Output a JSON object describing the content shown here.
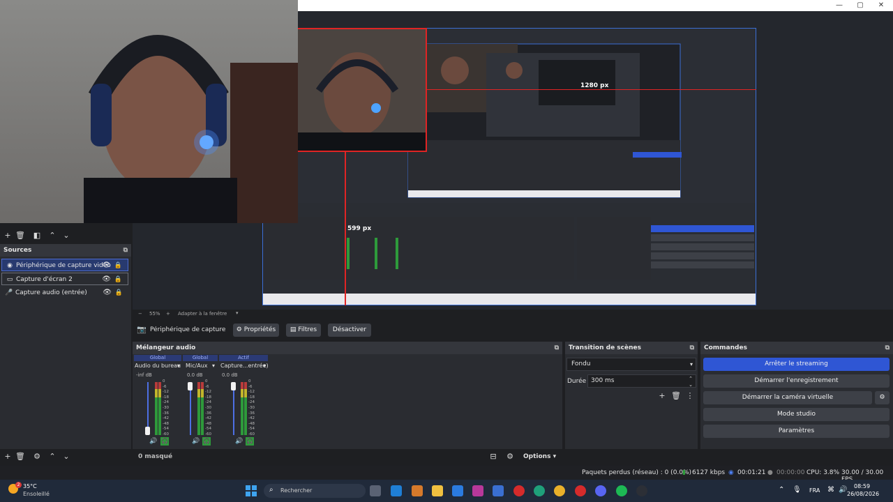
{
  "window": {
    "controls": {
      "minimize": "—",
      "maximize": "▢",
      "close": "✕"
    }
  },
  "preview": {
    "size_label_top": "1280 px",
    "size_label_left": "599 px",
    "zoom_minus": "−",
    "zoom": "55%",
    "zoom_plus": "+",
    "fit": "Adapter à la fenêtre"
  },
  "source_toolbar": {
    "source_name": "Périphérique de capture vidéo",
    "properties": "Propriétés",
    "filters": "Filtres",
    "deactivate": "Désactiver"
  },
  "sources": {
    "title": "Sources",
    "items": [
      {
        "label": "Périphérique de capture vidéo",
        "icon": "camera-icon"
      },
      {
        "label": "Capture d'écran 2",
        "icon": "monitor-icon"
      },
      {
        "label": "Capture audio (entrée)",
        "icon": "microphone-icon"
      }
    ]
  },
  "mixer": {
    "title": "Mélangeur audio",
    "channels": [
      {
        "badge": "Global",
        "name": "Audio du bureau",
        "db": "-inf dB",
        "fader_level": 0.1
      },
      {
        "badge": "Global",
        "name": "Mic/Aux",
        "db": "0.0 dB",
        "fader_level": 1.0
      },
      {
        "badge": "Actif",
        "name": "Capture...entrée)",
        "db": "0.0 dB",
        "fader_level": 1.0
      }
    ],
    "scale": [
      "0",
      "-6",
      "-12",
      "-18",
      "-24",
      "-30",
      "-36",
      "-42",
      "-48",
      "-54",
      "-60"
    ],
    "hidden_count": "0 masqué",
    "options": "Options"
  },
  "transitions": {
    "title": "Transition de scènes",
    "selected": "Fondu",
    "duration_label": "Durée",
    "duration_value": "300 ms"
  },
  "commands": {
    "title": "Commandes",
    "stop_streaming": "Arrêter le streaming",
    "start_recording": "Démarrer l'enregistrement",
    "start_virtual_cam": "Démarrer la caméra virtuelle",
    "studio_mode": "Mode studio",
    "settings": "Paramètres"
  },
  "status": {
    "dropped_frames": "Paquets perdus (réseau) : 0 (0.0%)",
    "bitrate": "6127 kbps",
    "stream_time": "00:01:21",
    "rec_time": "00:00:00",
    "cpu": "CPU: 3.8%",
    "fps": "30.00 / 30.00 FPS"
  },
  "taskbar": {
    "weather_temp": "35°C",
    "weather_desc": "Ensoleillé",
    "weather_badge": "2",
    "search_placeholder": "Rechercher",
    "lang": "FRA",
    "time": "08:59",
    "date": "26/08/2026"
  },
  "colors": {
    "accent": "#2f56d4",
    "panel": "#2a2c31",
    "header": "#34363c",
    "selection_red": "#e02424"
  }
}
